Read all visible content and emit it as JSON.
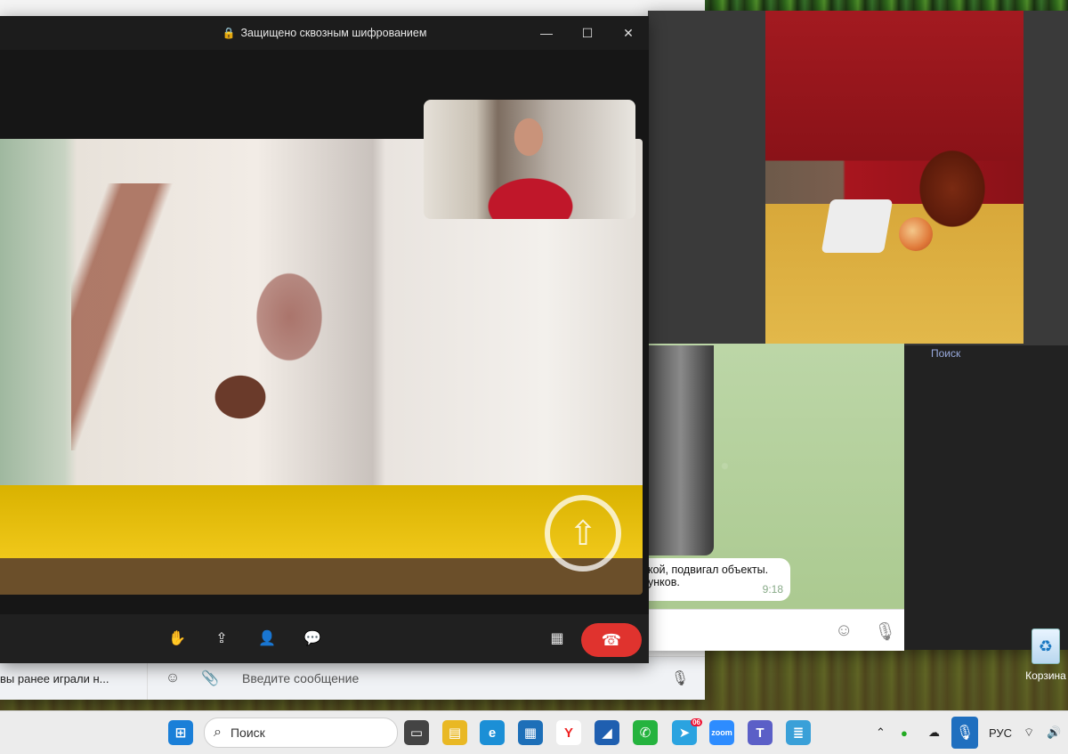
{
  "call": {
    "title": "Защищено сквозным шифрованием",
    "lock_icon": "lock-icon",
    "controls": [
      "raise-hand-icon",
      "share-screen-icon",
      "add-participant-icon",
      "chat-icon",
      "layout-icon"
    ],
    "end_call_icon": "end-call-icon",
    "end_color": "#e0332e"
  },
  "chat_behind": {
    "preview_text": "вы ранее играли н...",
    "input_placeholder": "Введите сообщение"
  },
  "telegram": {
    "search_hint": "Поиск",
    "bubble_line1": "кой,  подвигал объекты.",
    "bubble_line2": "унков.",
    "bubble_time": "9:18"
  },
  "desktop": {
    "recycle_label": "Корзина"
  },
  "taskbar": {
    "search_label": "Поиск",
    "lang": "РУС",
    "telegram_badge": "06",
    "zoom_label": "zoom"
  }
}
